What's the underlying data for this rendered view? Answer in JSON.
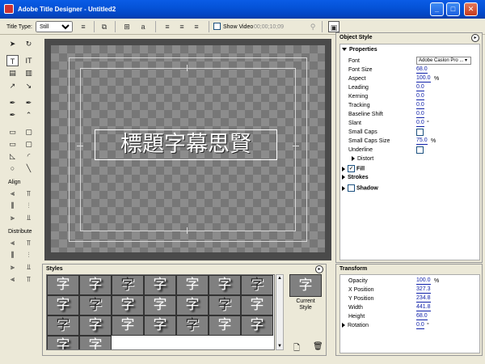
{
  "window": {
    "title": "Adobe Title Designer - Untitled2",
    "minimize": "_",
    "maximize": "□",
    "close": "✕"
  },
  "toolbar": {
    "title_type_label": "Title Type:",
    "title_type_value": "Still",
    "show_video_label": "Show Video",
    "timecode": "00;00;10;09"
  },
  "tools": {
    "align_label": "Align",
    "distribute_label": "Distribute"
  },
  "canvas": {
    "title_text": "標題字幕思賢"
  },
  "object_style": {
    "title": "Object Style",
    "properties_label": "Properties",
    "font_label": "Font",
    "font_value": "Adobe Caslon Pro ...",
    "font_size_label": "Font Size",
    "font_size_value": "68.0",
    "aspect_label": "Aspect",
    "aspect_value": "100.0",
    "aspect_unit": "%",
    "leading_label": "Leading",
    "leading_value": "0.0",
    "kerning_label": "Kerning",
    "kerning_value": "0.0",
    "tracking_label": "Tracking",
    "tracking_value": "0.0",
    "baseline_label": "Baseline Shift",
    "baseline_value": "0.0",
    "slant_label": "Slant",
    "slant_value": "0.0",
    "slant_unit": "°",
    "small_caps_label": "Small Caps",
    "small_caps_size_label": "Small Caps Size",
    "small_caps_size_value": "75.0",
    "small_caps_size_unit": "%",
    "underline_label": "Underline",
    "distort_label": "Distort",
    "fill_label": "Fill",
    "strokes_label": "Strokes",
    "shadow_label": "Shadow"
  },
  "styles": {
    "title": "Styles",
    "glyph": "字",
    "current_style_label_1": "Current",
    "current_style_label_2": "Style"
  },
  "transform": {
    "title": "Transform",
    "opacity_label": "Opacity",
    "opacity_value": "100.0",
    "opacity_unit": "%",
    "x_label": "X Position",
    "x_value": "327.3",
    "y_label": "Y Position",
    "y_value": "234.8",
    "width_label": "Width",
    "width_value": "441.8",
    "height_label": "Height",
    "height_value": "68.0",
    "rotation_label": "Rotation",
    "rotation_value": "0.0",
    "rotation_unit": "°"
  }
}
